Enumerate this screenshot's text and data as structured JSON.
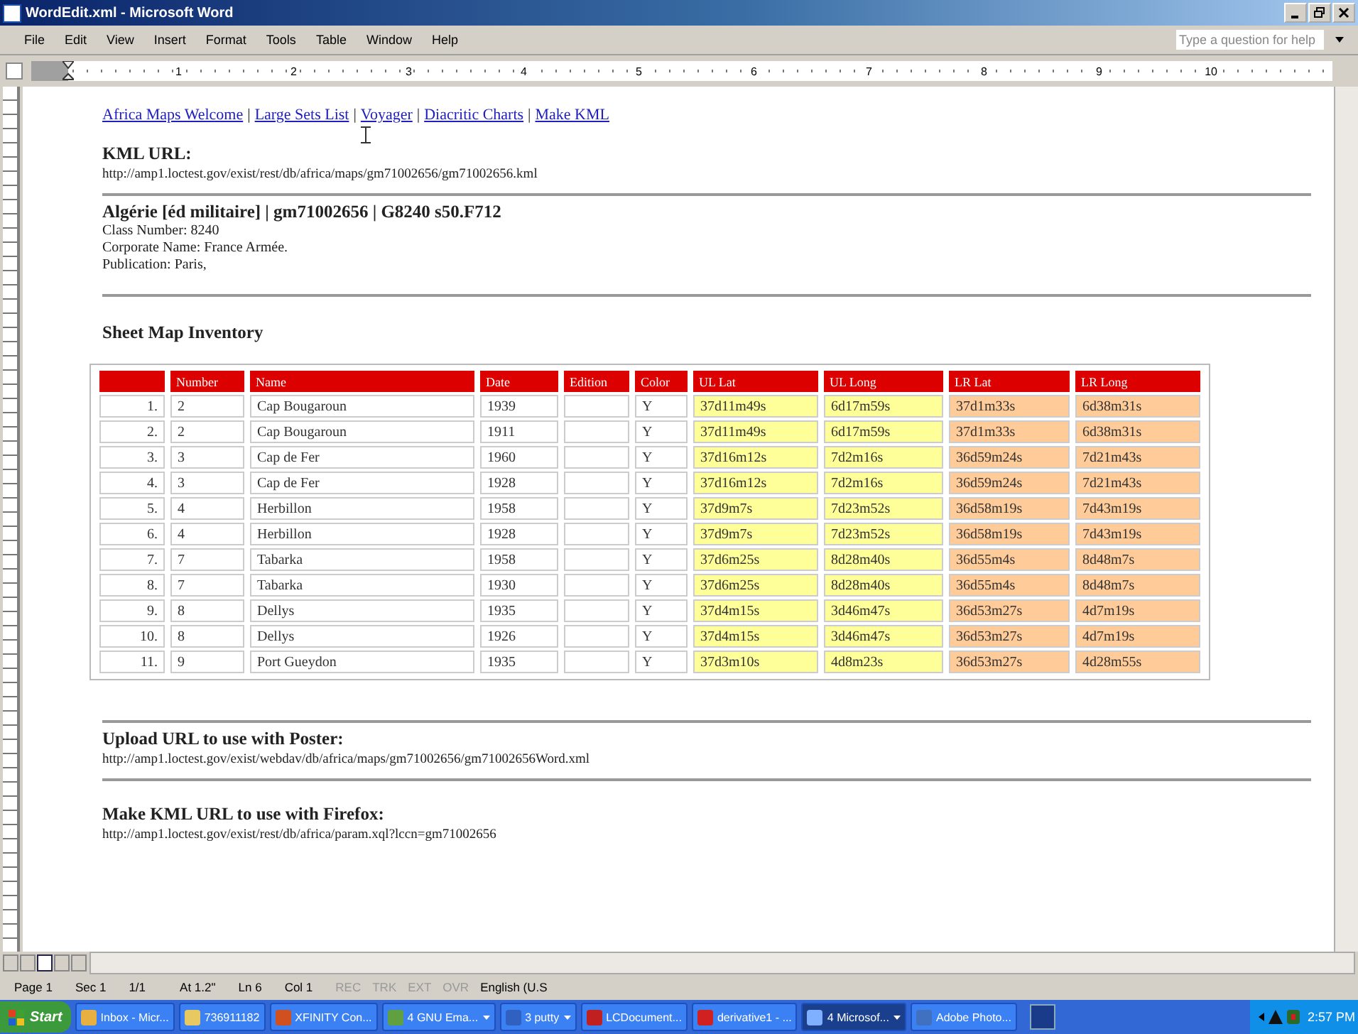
{
  "window": {
    "title": "WordEdit.xml - Microsoft Word"
  },
  "menu": [
    "File",
    "Edit",
    "View",
    "Insert",
    "Format",
    "Tools",
    "Table",
    "Window",
    "Help"
  ],
  "help_box": {
    "placeholder": "Type a question for help"
  },
  "ruler": {
    "labels": [
      "1",
      "2",
      "3",
      "4",
      "5",
      "6",
      "7",
      "8",
      "9",
      "10"
    ]
  },
  "document": {
    "nav_links": [
      "Africa Maps Welcome",
      "Large Sets List",
      "Voyager",
      "Diacritic Charts",
      "Make KML"
    ],
    "nav_separators": [
      "|",
      "|",
      "|",
      "|"
    ],
    "kml": {
      "heading": "KML URL:",
      "url": "http://amp1.loctest.gov/exist/rest/db/africa/maps/gm71002656/gm71002656.kml"
    },
    "record": {
      "title": "Algérie [éd militaire] | gm71002656 | G8240 s50.F712",
      "lines": [
        "Class Number: 8240",
        "Corporate Name: France Armée.",
        "Publication: Paris,"
      ]
    },
    "inventory": {
      "heading": "Sheet Map Inventory",
      "columns": [
        {
          "kind": "index",
          "color": "#ffffff"
        },
        {
          "kind": "text",
          "label": "Number",
          "color": "#ffffff"
        },
        {
          "kind": "text",
          "label": "Name",
          "color": "#ffffff"
        },
        {
          "kind": "text",
          "label": "Date",
          "color": "#ffffff"
        },
        {
          "kind": "text",
          "label": "Edition",
          "color": "#ffffff"
        },
        {
          "kind": "text",
          "label": "Color",
          "color": "#ffffff"
        },
        {
          "kind": "text",
          "label": "UL Lat",
          "color": "#ffff99"
        },
        {
          "kind": "text",
          "label": "UL Long",
          "color": "#ffff99"
        },
        {
          "kind": "text",
          "label": "LR Lat",
          "color": "#ffcc99"
        },
        {
          "kind": "text",
          "label": "LR Long",
          "color": "#ffcc99"
        }
      ],
      "rows": [
        [
          "1.",
          "2",
          "Cap  Bougaroun",
          "1939",
          null,
          "Y",
          "37d11m49s",
          "6d17m59s",
          "37d1m33s",
          "6d38m31s"
        ],
        [
          "2.",
          "2",
          "Cap  Bougaroun",
          "1911",
          null,
          "Y",
          "37d11m49s",
          "6d17m59s",
          "37d1m33s",
          "6d38m31s"
        ],
        [
          "3.",
          "3",
          "Cap de  Fer",
          "1960",
          null,
          "Y",
          "37d16m12s",
          "7d2m16s",
          "36d59m24s",
          "7d21m43s"
        ],
        [
          "4.",
          "3",
          "Cap de  Fer",
          "1928",
          null,
          "Y",
          "37d16m12s",
          "7d2m16s",
          "36d59m24s",
          "7d21m43s"
        ],
        [
          "5.",
          "4",
          "Herbillon",
          "1958",
          null,
          "Y",
          "37d9m7s",
          "7d23m52s",
          "36d58m19s",
          "7d43m19s"
        ],
        [
          "6.",
          "4",
          "Herbillon",
          "1928",
          null,
          "Y",
          "37d9m7s",
          "7d23m52s",
          "36d58m19s",
          "7d43m19s"
        ],
        [
          "7.",
          "7",
          "Tabarka",
          "1958",
          null,
          "Y",
          "37d6m25s",
          "8d28m40s",
          "36d55m4s",
          "8d48m7s"
        ],
        [
          "8.",
          "7",
          "Tabarka",
          "1930",
          null,
          "Y",
          "37d6m25s",
          "8d28m40s",
          "36d55m4s",
          "8d48m7s"
        ],
        [
          "9.",
          "8",
          "Dellys",
          "1935",
          null,
          "Y",
          "37d4m15s",
          "3d46m47s",
          "36d53m27s",
          "4d7m19s"
        ],
        [
          "10.",
          "8",
          "Dellys",
          "1926",
          null,
          "Y",
          "37d4m15s",
          "3d46m47s",
          "36d53m27s",
          "4d7m19s"
        ],
        [
          "11.",
          "9",
          "Port  Gueydon",
          "1935",
          null,
          "Y",
          "37d3m10s",
          "4d8m23s",
          "36d53m27s",
          "4d28m55s"
        ]
      ]
    },
    "upload": {
      "heading": "Upload URL to use with Poster:",
      "url": "http://amp1.loctest.gov/exist/webdav/db/africa/maps/gm71002656/gm71002656Word.xml"
    },
    "make_kml": {
      "heading": "Make KML URL to use with Firefox:",
      "url": "http://amp1.loctest.gov/exist/rest/db/africa/param.xql?lccn=gm71002656"
    }
  },
  "status_bar": [
    {
      "text": "Page 1",
      "disabled": false
    },
    {
      "text": "Sec 1",
      "disabled": false
    },
    {
      "text": "1/1",
      "disabled": false
    },
    {
      "text": "At 1.2\"",
      "disabled": false
    },
    {
      "text": "Ln 6",
      "disabled": false
    },
    {
      "text": "Col 1",
      "disabled": false
    },
    {
      "text": "REC",
      "disabled": true
    },
    {
      "text": "TRK",
      "disabled": true
    },
    {
      "text": "EXT",
      "disabled": true
    },
    {
      "text": "OVR",
      "disabled": true
    },
    {
      "text": "English (U.S",
      "disabled": false
    }
  ],
  "taskbar": {
    "start": "Start",
    "items": [
      {
        "label": "Inbox - Micr...",
        "selected": false,
        "color": "#e8b040",
        "menu": false
      },
      {
        "label": "736911182",
        "selected": false,
        "color": "#e8c860",
        "menu": false
      },
      {
        "label": "XFINITY Con...",
        "selected": false,
        "color": "#d05020",
        "menu": false
      },
      {
        "label": "4 GNU Ema...",
        "selected": false,
        "color": "#60a040",
        "menu": true
      },
      {
        "label": "3 putty",
        "selected": false,
        "color": "#3060c0",
        "menu": true
      },
      {
        "label": "LCDocument...",
        "selected": false,
        "color": "#c02020",
        "menu": false
      },
      {
        "label": "derivative1 - ...",
        "selected": false,
        "color": "#d02020",
        "menu": false
      },
      {
        "label": "4 Microsof...",
        "selected": true,
        "color": "#7fb0ff",
        "menu": true
      },
      {
        "label": "Adobe Photo...",
        "selected": false,
        "color": "#4070c0",
        "menu": false
      }
    ],
    "clock": "2:57 PM"
  }
}
